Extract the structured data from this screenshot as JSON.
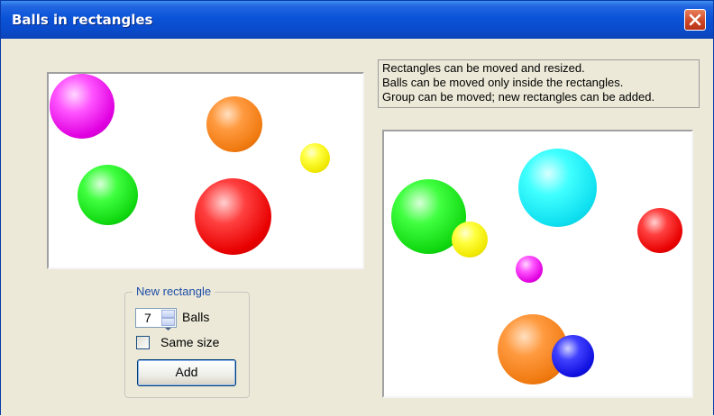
{
  "window": {
    "title": "Balls in rectangles"
  },
  "colors": {
    "titlebar": "#0a4ccc",
    "client": "#ece9d8",
    "close": "#cc4422"
  },
  "info": {
    "lines": [
      "Rectangles can be moved and resized.",
      "Balls can be moved only inside the rectangles.",
      "Group can be moved; new rectangles can be added."
    ]
  },
  "rectangles": [
    {
      "name": "left-rectangle",
      "balls": [
        "magenta",
        "orange",
        "yellow",
        "green",
        "red"
      ]
    },
    {
      "name": "right-rectangle",
      "balls": [
        "green",
        "yellow",
        "cyan",
        "red",
        "magenta",
        "orange",
        "blue"
      ]
    }
  ],
  "new_rectangle": {
    "legend": "New rectangle",
    "balls_value": "7",
    "balls_label": "Balls",
    "same_size_label": "Same size",
    "same_size_checked": false,
    "add_label": "Add"
  },
  "icons": {
    "close": "close-icon",
    "spin_up": "spin-up-icon",
    "spin_down": "spin-down-icon"
  }
}
